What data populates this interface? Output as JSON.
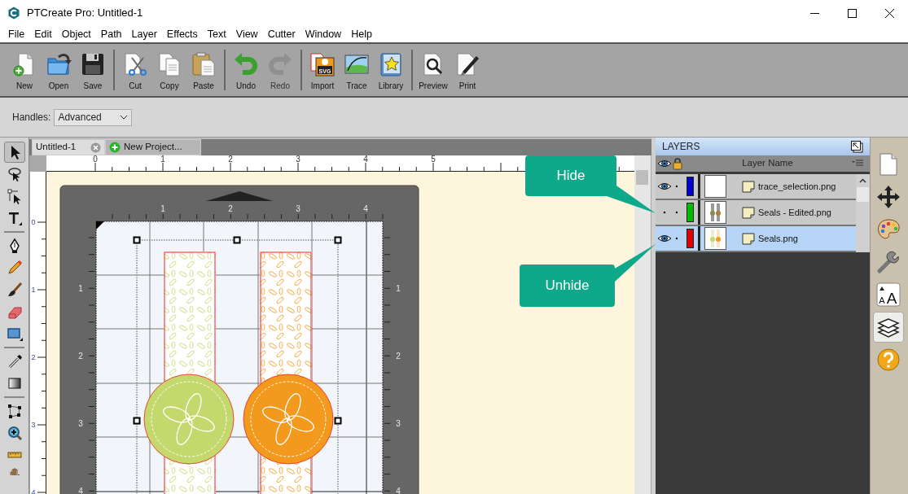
{
  "window": {
    "title": "PTCreate Pro: Untitled-1"
  },
  "menu": [
    "File",
    "Edit",
    "Object",
    "Path",
    "Layer",
    "Effects",
    "Text",
    "View",
    "Cutter",
    "Window",
    "Help"
  ],
  "toolbar": [
    {
      "kind": "new",
      "label": "New",
      "disabled": false
    },
    {
      "kind": "open",
      "label": "Open",
      "disabled": false
    },
    {
      "kind": "save",
      "label": "Save",
      "disabled": false
    },
    {
      "kind": "separator"
    },
    {
      "kind": "cut",
      "label": "Cut",
      "disabled": false
    },
    {
      "kind": "copy",
      "label": "Copy",
      "disabled": false
    },
    {
      "kind": "paste",
      "label": "Paste",
      "disabled": false
    },
    {
      "kind": "separator"
    },
    {
      "kind": "undo",
      "label": "Undo",
      "disabled": false
    },
    {
      "kind": "redo",
      "label": "Redo",
      "disabled": true
    },
    {
      "kind": "separator"
    },
    {
      "kind": "import",
      "label": "Import",
      "disabled": false,
      "icon_text": "SVG"
    },
    {
      "kind": "trace",
      "label": "Trace",
      "disabled": false
    },
    {
      "kind": "library",
      "label": "Library",
      "disabled": false
    },
    {
      "kind": "separator"
    },
    {
      "kind": "preview",
      "label": "Preview",
      "disabled": false
    },
    {
      "kind": "print",
      "label": "Print",
      "disabled": false
    }
  ],
  "options": {
    "label": "Handles:",
    "value": "Advanced"
  },
  "tools": [
    {
      "kind": "select",
      "selected": true
    },
    {
      "kind": "lasso",
      "selected": false
    },
    {
      "kind": "node-select",
      "selected": false
    },
    {
      "kind": "text",
      "selected": false
    },
    {
      "kind": "separator"
    },
    {
      "kind": "pen",
      "selected": false
    },
    {
      "kind": "pencil",
      "selected": false
    },
    {
      "kind": "brush",
      "selected": false
    },
    {
      "kind": "eraser",
      "selected": false
    },
    {
      "kind": "rectangle",
      "selected": false
    },
    {
      "kind": "separator"
    },
    {
      "kind": "eyedropper",
      "selected": false
    },
    {
      "kind": "gradient",
      "selected": false
    },
    {
      "kind": "separator"
    },
    {
      "kind": "shape-edit",
      "selected": false
    },
    {
      "kind": "zoom",
      "selected": false
    },
    {
      "kind": "ruler",
      "selected": false
    },
    {
      "kind": "hand",
      "selected": false
    }
  ],
  "tabs": [
    {
      "kind": "document",
      "label": "Untitled-1",
      "selected": true
    },
    {
      "kind": "new",
      "label": "New Project...",
      "selected": false
    }
  ],
  "rulers": {
    "horizontal": [
      "0",
      "1",
      "2",
      "3",
      "4",
      "5"
    ],
    "vertical": [
      "0",
      "1",
      "2",
      "3",
      "4"
    ]
  },
  "mat": {
    "top_ruler": [
      "1",
      "2",
      "3",
      "4"
    ],
    "left_ruler": [
      "1",
      "2",
      "3",
      "4"
    ],
    "right_ruler": [
      "1",
      "2",
      "3",
      "4"
    ]
  },
  "design": {
    "seals": [
      {
        "color": "#c5d86d"
      },
      {
        "color": "#f39a1e"
      }
    ]
  },
  "layers_panel": {
    "title": "LAYERS",
    "column": "Layer Name",
    "rows": [
      {
        "name": "trace_selection.png",
        "visible": true,
        "locked": false,
        "selected": false,
        "color": "#0000cc",
        "kind": "blank"
      },
      {
        "name": "Seals - Edited.png",
        "visible": false,
        "locked": false,
        "selected": false,
        "color": "#00bb00",
        "kind": "muted"
      },
      {
        "name": "Seals.png",
        "visible": true,
        "locked": false,
        "selected": true,
        "color": "#dd0000",
        "kind": "color"
      }
    ]
  },
  "side_panel": [
    {
      "kind": "page",
      "selected": false
    },
    {
      "kind": "move",
      "selected": false
    },
    {
      "kind": "palette",
      "selected": false
    },
    {
      "kind": "wrench",
      "selected": false
    },
    {
      "kind": "font-size",
      "selected": false,
      "glyphs": [
        "A",
        "A"
      ]
    },
    {
      "kind": "layers",
      "selected": true
    },
    {
      "kind": "help",
      "selected": false
    }
  ],
  "callouts": [
    {
      "text": "Hide"
    },
    {
      "text": "Unhide"
    }
  ]
}
